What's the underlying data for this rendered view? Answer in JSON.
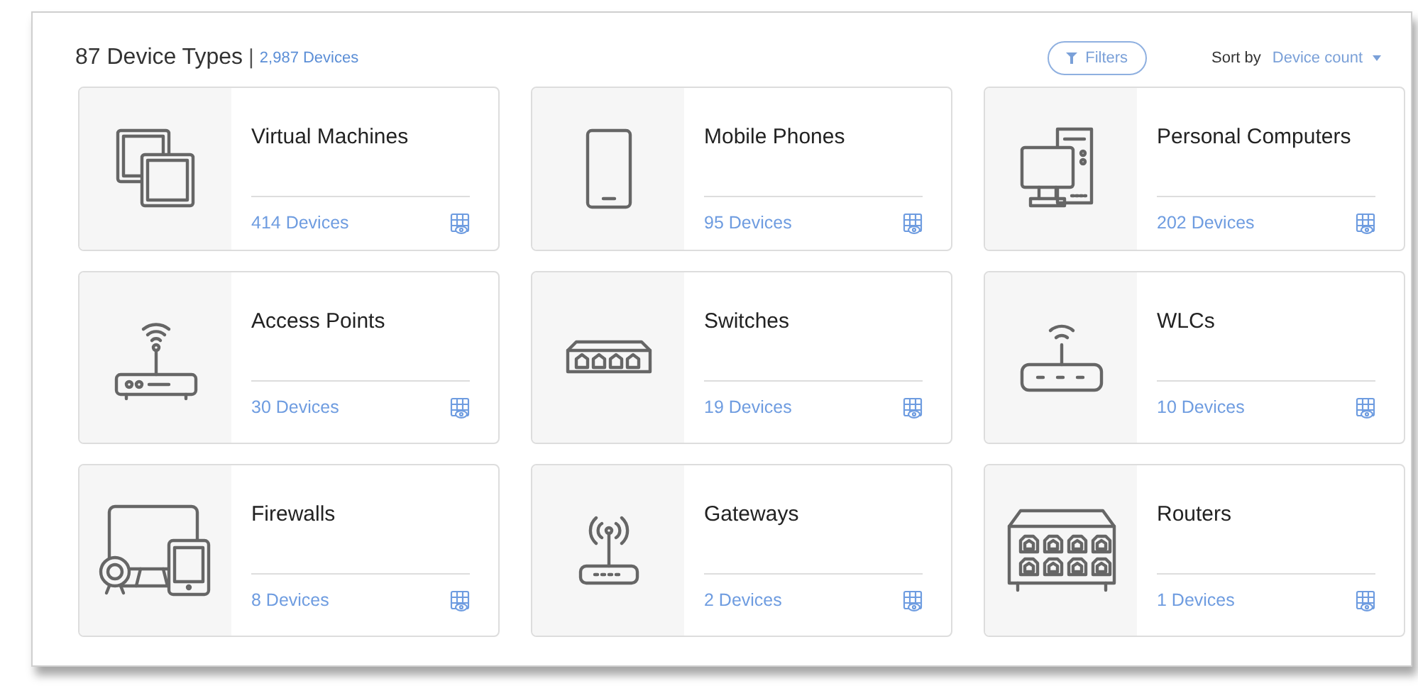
{
  "header": {
    "title": "87 Device Types",
    "separator": "|",
    "total": "2,987 Devices",
    "filter_button": "Filters",
    "sort_label": "Sort by",
    "sort_value": "Device count"
  },
  "cards": [
    {
      "kind": "vm",
      "title": "Virtual Machines",
      "count": "414 Devices"
    },
    {
      "kind": "phone",
      "title": "Mobile Phones",
      "count": "95 Devices"
    },
    {
      "kind": "pc",
      "title": "Personal Computers",
      "count": "202 Devices"
    },
    {
      "kind": "ap",
      "title": "Access Points",
      "count": "30 Devices"
    },
    {
      "kind": "switch",
      "title": "Switches",
      "count": "19 Devices"
    },
    {
      "kind": "wlc",
      "title": "WLCs",
      "count": "10 Devices"
    },
    {
      "kind": "firewall",
      "title": "Firewalls",
      "count": "8 Devices"
    },
    {
      "kind": "gateway",
      "title": "Gateways",
      "count": "2 Devices"
    },
    {
      "kind": "router",
      "title": "Routers",
      "count": "1 Devices"
    }
  ]
}
